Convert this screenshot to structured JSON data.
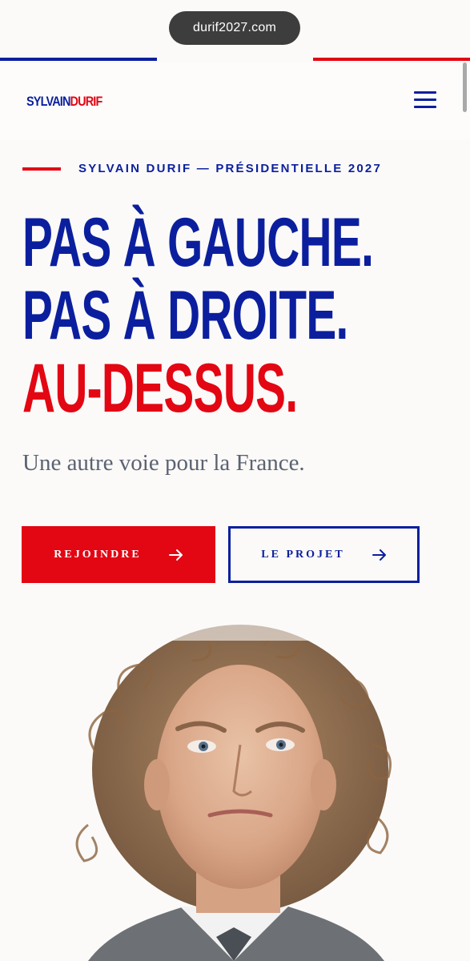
{
  "browser": {
    "url": "durif2027.com"
  },
  "header": {
    "logo_first": "SYLVAIN",
    "logo_last": "DURIF",
    "menu_icon": "hamburger-menu-icon"
  },
  "hero": {
    "eyebrow": "SYLVAIN DURIF — PRÉSIDENTIELLE 2027",
    "headline_line1": "PAS À GAUCHE.",
    "headline_line2": "PAS À DROITE.",
    "headline_line3": "AU-DESSUS.",
    "tagline": "Une autre voie pour la France.",
    "btn_join": "REJOINDRE",
    "btn_project": "LE PROJET",
    "arrow_icon": "arrow-right-icon"
  },
  "colors": {
    "brand_blue": "#0b1f9e",
    "brand_red": "#e30613",
    "background": "#fbfaf8",
    "tagline_gray": "#5b6272"
  }
}
